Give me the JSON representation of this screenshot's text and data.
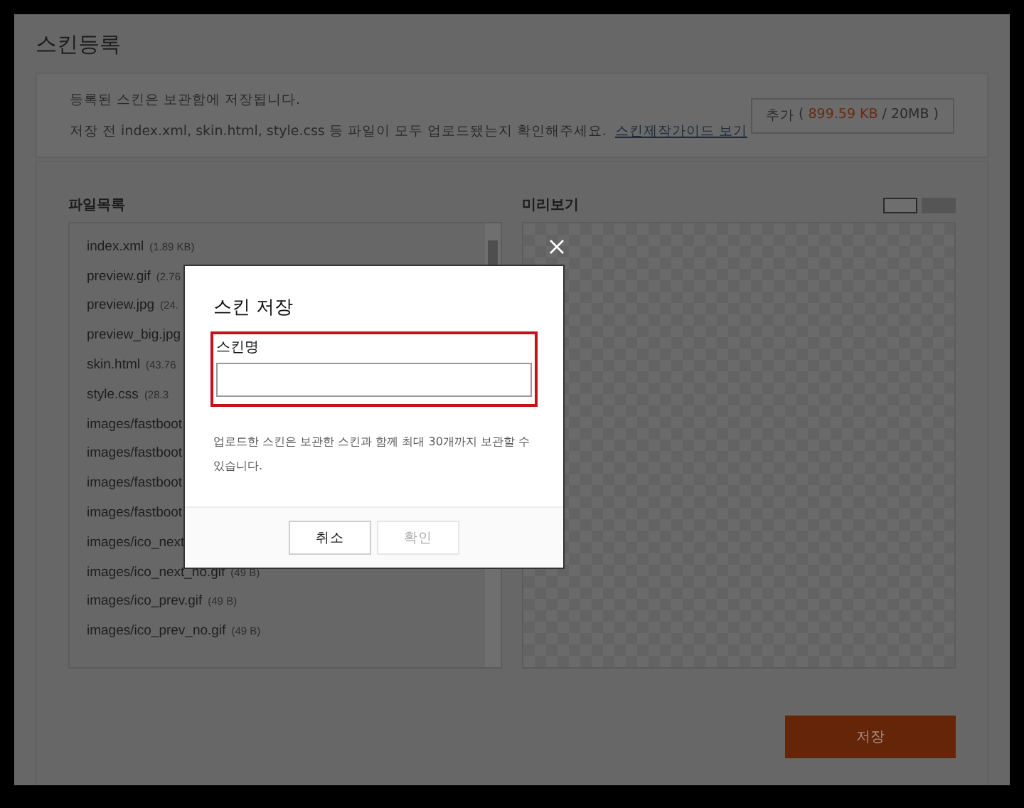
{
  "page": {
    "title": "스킨등록"
  },
  "info": {
    "line_1": "등록된 스킨은 보관함에 저장됩니다.",
    "line_2": "저장 전 index.xml, skin.html, style.css 등 파일이 모두 업로드됐는지 확인해주세요.",
    "guide_link": "스킨제작가이드 보기"
  },
  "capacity": {
    "label": "추가",
    "open": "(",
    "used": "899.59 KB",
    "separator": "/",
    "limit": "20MB",
    "close": ")"
  },
  "file_list": {
    "title": "파일목록",
    "files": [
      {
        "name": "index.xml",
        "size": "(1.89 KB)"
      },
      {
        "name": "preview.gif",
        "size": "(2.76"
      },
      {
        "name": "preview.jpg",
        "size": "(24."
      },
      {
        "name": "preview_big.jpg"
      },
      {
        "name": "skin.html",
        "size": "(43.76"
      },
      {
        "name": "style.css",
        "size": "(28.3"
      },
      {
        "name": "images/fastboot"
      },
      {
        "name": "images/fastboot"
      },
      {
        "name": "images/fastboot"
      },
      {
        "name": "images/fastboot"
      },
      {
        "name": "images/ico_next"
      },
      {
        "name": "images/ico_next_no.gif",
        "size": "(49 B)"
      },
      {
        "name": "images/ico_prev.gif",
        "size": "(49 B)"
      },
      {
        "name": "images/ico_prev_no.gif",
        "size": "(49 B)"
      }
    ]
  },
  "preview": {
    "title": "미리보기",
    "modes": [
      {
        "selected": true
      },
      {
        "selected": false
      }
    ]
  },
  "save_button": "저장",
  "dialog": {
    "title": "스킨 저장",
    "field_label": "스킨명",
    "notice": "업로드한 스킨은 보관한 스킨과 함께 최대 30개까지 보관할 수 있습니다.",
    "buttons": [
      {
        "label": "취소",
        "disabled": false
      },
      {
        "label": "확인",
        "disabled": true
      }
    ]
  }
}
